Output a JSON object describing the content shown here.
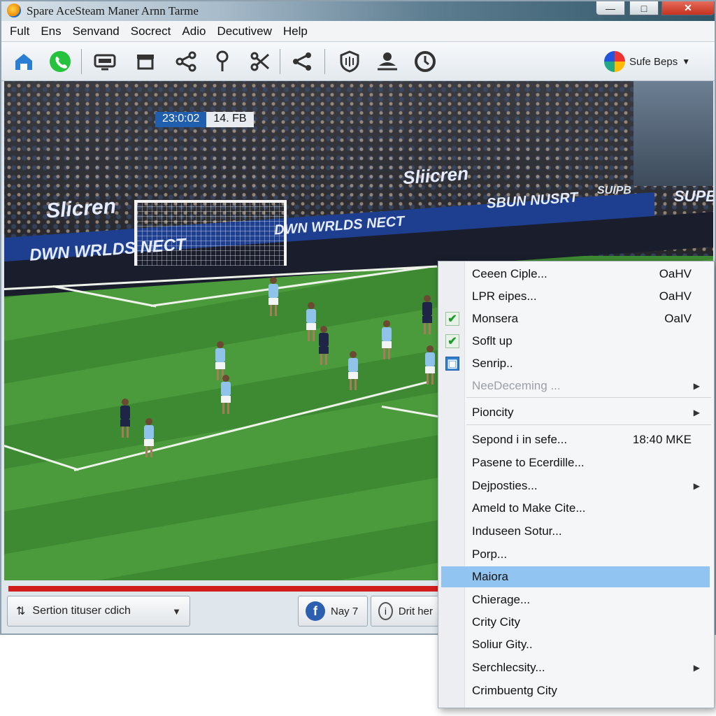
{
  "window": {
    "title": "Spare AceSteam Maner Arnn Tarme"
  },
  "menubar": [
    "Fult",
    "Ens",
    "Senvand",
    "Socrect",
    "Adio",
    "Decutivew",
    "Help"
  ],
  "toolbar": {
    "icons": [
      "home-icon",
      "whatsapp-icon",
      "tv-icon",
      "screen-icon",
      "share-icon",
      "pin-icon",
      "scissors-icon",
      "share-alt-icon",
      "shield-icon",
      "user-icon",
      "clock-icon"
    ],
    "right_label": "Sufe Beps"
  },
  "video": {
    "scorebug_time": "23:0:02",
    "scorebug_team": "14. FB",
    "ads": [
      "Sliicren",
      "Slicren",
      "DWN WRLDS NECT",
      "DWN WRLDS NECT",
      "SBUN NUSRT",
      "SUIPB",
      "SUPB"
    ]
  },
  "controls": {
    "progress_fraction": 1.0,
    "source_select": "Sertion tituser cdich",
    "btn1_label": "Nay 7",
    "btn2_label": "Drit her"
  },
  "context_menu": {
    "items": [
      {
        "label": "Ceeen Ciple...",
        "shortcut": "OaHV",
        "check": false
      },
      {
        "label": "LPR eipes...",
        "shortcut": "OaHV",
        "check": false
      },
      {
        "label": "Monsera",
        "shortcut": "OaIV",
        "check": true
      },
      {
        "label": "Soflt up",
        "shortcut": "",
        "check": true
      },
      {
        "label": "Senrip..",
        "shortcut": "",
        "check": false,
        "icon": true
      },
      {
        "label": "NeeDeceming ...",
        "shortcut": "",
        "disabled": true,
        "submenu": true
      },
      {
        "label": "Pioncity",
        "shortcut": "",
        "submenu": true
      },
      {
        "label": "Sepond i in sefe...",
        "shortcut": "18:40 MKE"
      },
      {
        "label": "Pasene to Ecerdille...",
        "shortcut": ""
      },
      {
        "label": "Dejposties...",
        "shortcut": "",
        "submenu": true
      },
      {
        "label": "Ameld to Make Cite...",
        "shortcut": ""
      },
      {
        "label": "Induseen Sotur...",
        "shortcut": ""
      },
      {
        "label": "Porp...",
        "shortcut": ""
      },
      {
        "label": "Maiora",
        "shortcut": "",
        "highlighted": true
      },
      {
        "label": "Chierage...",
        "shortcut": ""
      },
      {
        "label": "Crity City",
        "shortcut": ""
      },
      {
        "label": "Soliur Gity..",
        "shortcut": ""
      },
      {
        "label": "Serchlecsity...",
        "shortcut": "",
        "submenu": true
      },
      {
        "label": "Crimbuentg City",
        "shortcut": ""
      }
    ]
  },
  "colors": {
    "accent": "#1f5fae",
    "highlight": "#92c4f2",
    "progress": "#d21d1d",
    "check": "#1c9a2a"
  }
}
